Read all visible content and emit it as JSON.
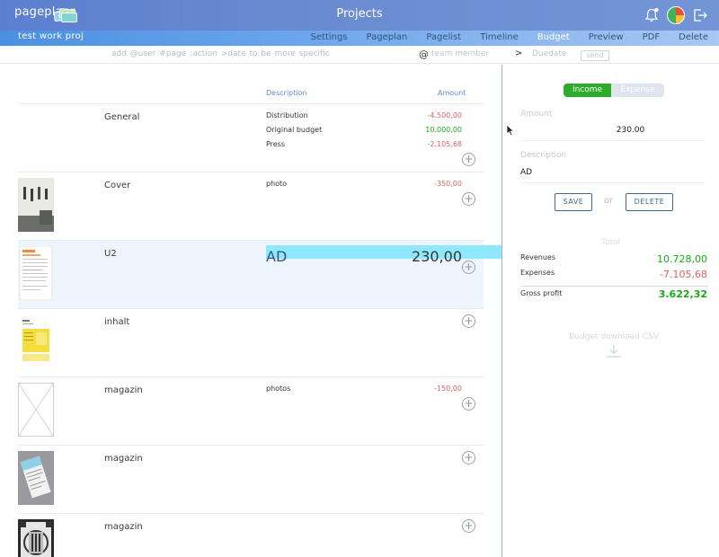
{
  "header": {
    "logo_text": "pageplanr",
    "title": "Projects"
  },
  "nav": {
    "project_name": "test work proj",
    "tabs": [
      {
        "label": "Settings",
        "active": false
      },
      {
        "label": "Pageplan",
        "active": false
      },
      {
        "label": "Pagelist",
        "active": false
      },
      {
        "label": "Timeline",
        "active": false
      },
      {
        "label": "Budget",
        "active": true
      },
      {
        "label": "Preview",
        "active": false
      },
      {
        "label": "PDF",
        "active": false
      },
      {
        "label": "Delete",
        "active": false
      }
    ]
  },
  "command_bar": {
    "hint": "add  @user  #page  :action  >date  to be more specific",
    "at": "@",
    "member_placeholder": "team member",
    "gt": ">",
    "duedate_placeholder": "Duedate",
    "send_label": "send"
  },
  "table": {
    "col_description": "Description",
    "col_amount": "Amount",
    "rows": [
      {
        "name": "General",
        "items": [
          {
            "desc": "Distribution",
            "amount": "-4.500,00"
          },
          {
            "desc": "Original budget",
            "amount": "10.000,00"
          },
          {
            "desc": "Press",
            "amount": "-2.105,68"
          }
        ]
      },
      {
        "name": "Cover",
        "items": [
          {
            "desc": "photo",
            "amount": "-350,00"
          }
        ]
      },
      {
        "name": "U2",
        "items": [
          {
            "desc": "AD",
            "amount": "230,00"
          }
        ]
      },
      {
        "name": "inhalt",
        "items": []
      },
      {
        "name": "magazin",
        "items": [
          {
            "desc": "photos",
            "amount": "-150,00"
          }
        ]
      },
      {
        "name": "magazin",
        "items": []
      },
      {
        "name": "magazin",
        "items": []
      }
    ],
    "plus": "+"
  },
  "panel": {
    "income_label": "Income",
    "expense_label": "Expense",
    "amount_label": "Amount",
    "amount_value": "230.00",
    "description_label": "Description",
    "description_value": "AD",
    "save_label": "SAVE",
    "or_label": "or",
    "delete_label": "DELETE",
    "total_label": "Total",
    "revenues_label": "Revenues",
    "revenues_value": "10.728,00",
    "expenses_label": "Expenses",
    "expenses_value": "-7.105,68",
    "gross_label": "Gross profit",
    "gross_value": "3.622,32",
    "csv_label": "Budget download CSV"
  },
  "colors": {
    "accent_blue": "#5b7fcf",
    "positive_green": "#1aaa1a",
    "negative_red": "#e06060",
    "highlight_cyan": "#8fe7fb"
  }
}
